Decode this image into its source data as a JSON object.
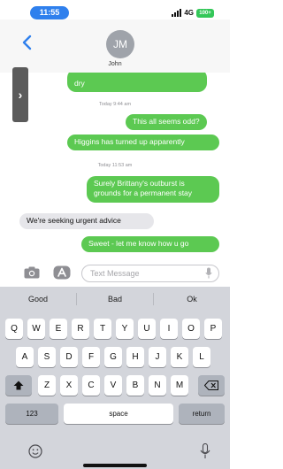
{
  "status_bar": {
    "time": "11:55",
    "network": "4G",
    "battery": "100+"
  },
  "contact": {
    "initials": "JM",
    "name": "John"
  },
  "messages": [
    {
      "text": "dry",
      "sender": "me"
    },
    {
      "timestamp": "Today 9:44 am"
    },
    {
      "text": "This all seems odd?",
      "sender": "me"
    },
    {
      "text": "Higgins has turned up apparently",
      "sender": "me"
    },
    {
      "timestamp": "Today 11:53 am"
    },
    {
      "text": "Surely Brittany's outburst is grounds for a permanent stay",
      "sender": "me"
    },
    {
      "text": "We're seeking urgent advice",
      "sender": "them"
    },
    {
      "text": "Sweet - let me know how u go",
      "sender": "me"
    }
  ],
  "compose": {
    "placeholder": "Text Message"
  },
  "keyboard": {
    "suggestions": [
      "Good",
      "Bad",
      "Ok"
    ],
    "row1": [
      "Q",
      "W",
      "E",
      "R",
      "T",
      "Y",
      "U",
      "I",
      "O",
      "P"
    ],
    "row2": [
      "A",
      "S",
      "D",
      "F",
      "G",
      "H",
      "J",
      "K",
      "L"
    ],
    "row3": [
      "Z",
      "X",
      "C",
      "V",
      "B",
      "N",
      "M"
    ],
    "numbers_label": "123",
    "space_label": "space",
    "return_label": "return"
  },
  "colors": {
    "outgoing_bubble": "#5cc952",
    "incoming_bubble": "#e6e6ea",
    "accent": "#2f80ed"
  }
}
